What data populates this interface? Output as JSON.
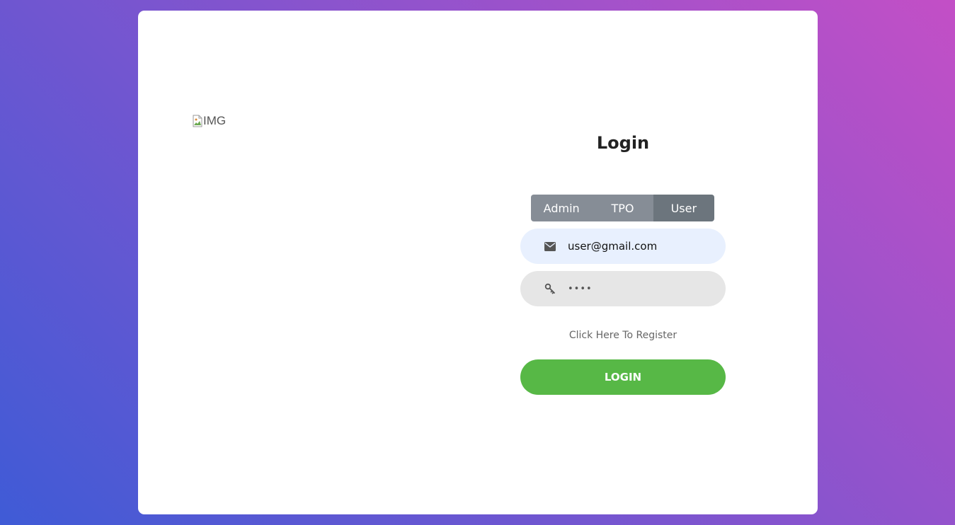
{
  "left_image": {
    "alt_text": "IMG",
    "icon": "broken-image-icon"
  },
  "form": {
    "title": "Login",
    "roles": [
      {
        "label": "Admin",
        "active": false
      },
      {
        "label": "TPO",
        "active": false
      },
      {
        "label": "User",
        "active": true
      }
    ],
    "email": {
      "value": "user@gmail.com",
      "icon": "envelope-icon"
    },
    "password": {
      "value": "••••",
      "icon": "key-icon"
    },
    "register_link": "Click Here To Register",
    "login_button": "LOGIN"
  },
  "colors": {
    "card": "#ffffff",
    "role_button": "#868d96",
    "role_button_active": "#6c757d",
    "email_bg": "#e8f0fe",
    "password_bg": "#e6e6e6",
    "login_button": "#57b846"
  }
}
